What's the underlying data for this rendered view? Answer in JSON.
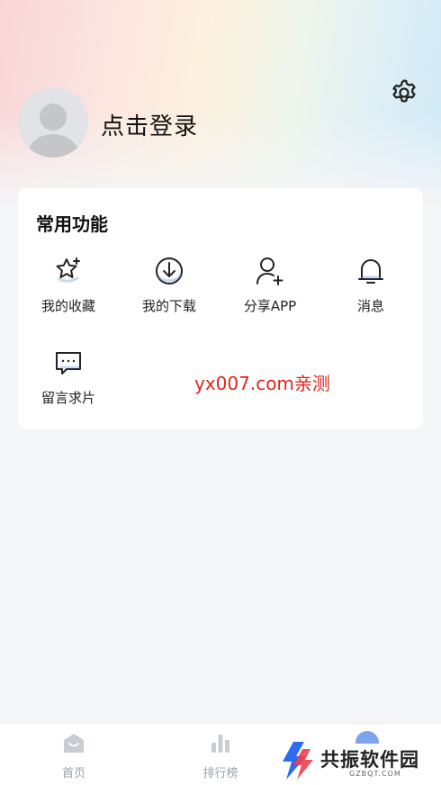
{
  "header": {
    "login_text": "点击登录"
  },
  "card": {
    "title": "常用功能",
    "functions": [
      {
        "label": "我的收藏",
        "icon": "star-icon"
      },
      {
        "label": "我的下载",
        "icon": "download-icon"
      },
      {
        "label": "分享APP",
        "icon": "add-user-icon"
      },
      {
        "label": "消息",
        "icon": "bell-icon"
      },
      {
        "label": "留言求片",
        "icon": "message-icon"
      }
    ],
    "watermark": "yx007.com亲测"
  },
  "tabbar": {
    "tabs": [
      {
        "label": "首页",
        "icon": "home-icon"
      },
      {
        "label": "排行榜",
        "icon": "chart-icon"
      }
    ]
  },
  "brand": {
    "name": "共振软件园",
    "sub": "GZBQT.COM"
  },
  "colors": {
    "accent_blue": "#5a8de8",
    "watermark_red": "#e0251b",
    "tab_gray": "#9aa0a8"
  }
}
